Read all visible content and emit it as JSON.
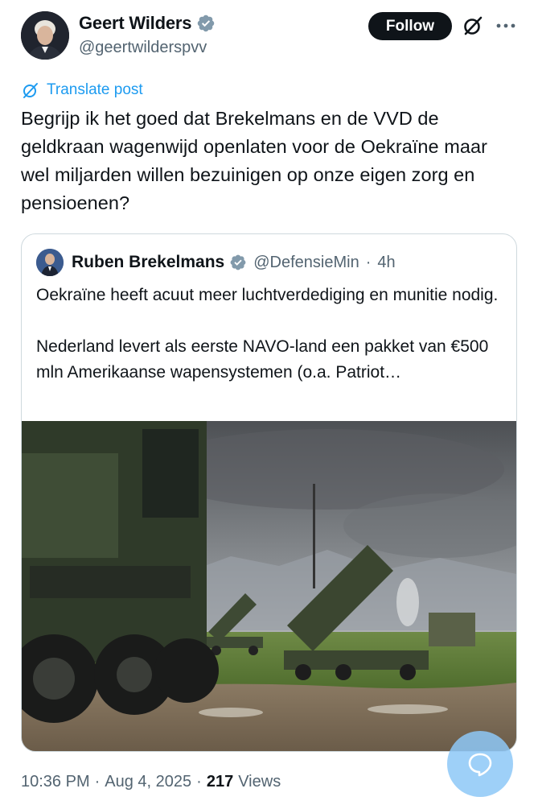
{
  "author": {
    "display_name": "Geert Wilders",
    "handle": "@geertwilderspvv",
    "verified": true
  },
  "header": {
    "follow_label": "Follow",
    "icons": [
      "verified-badge-icon",
      "grok-icon",
      "more-icon"
    ]
  },
  "translate_label": "Translate post",
  "post_text": "Begrijp ik het goed dat Brekelmans en de VVD de geldkraan wagenwijd openlaten voor de Oekraïne maar wel miljarden willen bezuinigen op onze eigen zorg en pensioenen?",
  "quoted_post": {
    "display_name": "Ruben Brekelmans",
    "handle": "@DefensieMin",
    "separator": "·",
    "time": "4h",
    "text": "Oekraïne heeft acuut meer luchtverdediging en munitie nodig.\n\nNederland levert als eerste NAVO-land een pakket van €500 mln Amerikaanse wapensystemen (o.a. Patriot…",
    "image_alt": "Military trucks and Patriot missile launchers in a green field under cloudy sky"
  },
  "meta": {
    "time": "10:36 PM",
    "separator": "·",
    "date": "Aug 4, 2025",
    "separator2": "·",
    "views_count": "217",
    "views_label": "Views"
  },
  "colors": {
    "accent": "#1d9bf0",
    "text": "#0f1419",
    "secondary": "#536471",
    "border": "#cfd9de"
  }
}
